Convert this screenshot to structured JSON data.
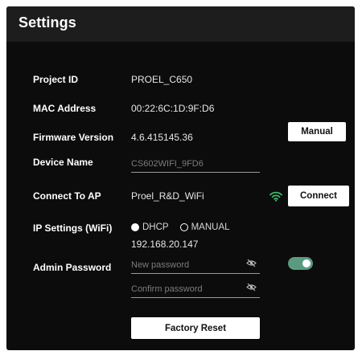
{
  "header": {
    "title": "Settings"
  },
  "project": {
    "label": "Project ID",
    "value": "PROEL_C650"
  },
  "mac": {
    "label": "MAC Address",
    "value": "00:22:6C:1D:9F:D6"
  },
  "firmware": {
    "label": "Firmware Version",
    "value": "4.6.415145.36",
    "button": "Manual"
  },
  "device": {
    "label": "Device Name",
    "placeholder": "CS602WIFI_9FD6"
  },
  "ap": {
    "label": "Connect To AP",
    "value": "Proel_R&D_WiFi",
    "button": "Connect",
    "icon": "wifi-icon",
    "icon_color": "#3db86a"
  },
  "ip": {
    "label": "IP Settings (WiFi)",
    "options": [
      "DHCP",
      "MANUAL"
    ],
    "selected": "DHCP",
    "address": "192.168.20.147"
  },
  "admin": {
    "label": "Admin Password",
    "new_placeholder": "New password",
    "confirm_placeholder": "Confirm password",
    "toggle_on": true,
    "toggle_color": "#5a9a80"
  },
  "footer": {
    "reset_button": "Factory Reset"
  }
}
